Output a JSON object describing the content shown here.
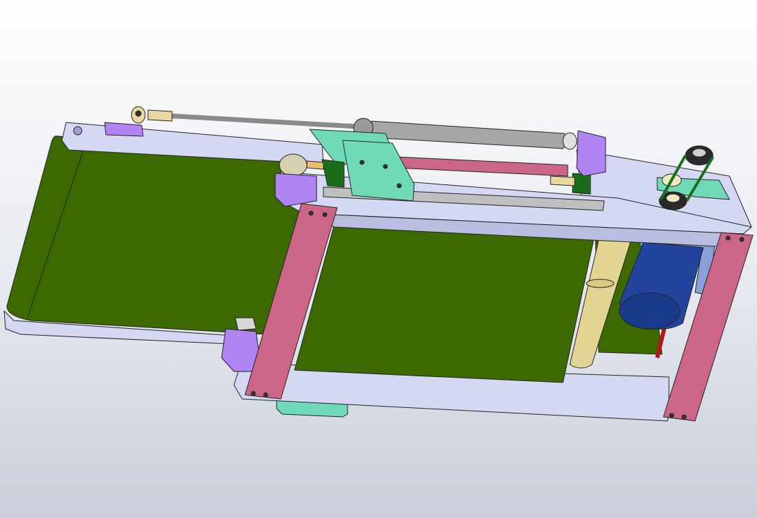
{
  "viewport": {
    "background": [
      "#ffffff",
      "#c9ced8"
    ]
  },
  "colors": {
    "belt": "#3d6a00",
    "frame": "#d4d8f2",
    "frame_shade": "#b9bee0",
    "leg": "#cc6688",
    "slide_block": "#6fd9b8",
    "bracket": "#b084f2",
    "olive_bracket": "#1a6e1a",
    "cylinder": "#a6a6a6",
    "rod_end": "#e8d8a0",
    "roller": "#e3d494",
    "motor": "#22449c",
    "pulley": "#2a2a2a",
    "red_rod": "#b01818"
  },
  "components": [
    "belt-left",
    "belt-right",
    "side-frame-front",
    "side-frame-back",
    "support-leg-front",
    "support-leg-rear",
    "air-cylinder",
    "slide-carriage",
    "linear-guide-rail",
    "drive-motor",
    "idler-roller",
    "timing-pulley",
    "belt-tensioner-bracket"
  ]
}
